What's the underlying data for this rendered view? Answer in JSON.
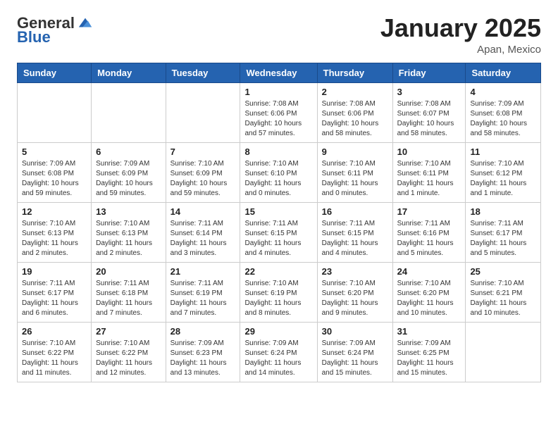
{
  "logo": {
    "general": "General",
    "blue": "Blue"
  },
  "title": {
    "month_year": "January 2025",
    "location": "Apan, Mexico"
  },
  "weekdays": [
    "Sunday",
    "Monday",
    "Tuesday",
    "Wednesday",
    "Thursday",
    "Friday",
    "Saturday"
  ],
  "weeks": [
    [
      {
        "day": "",
        "info": ""
      },
      {
        "day": "",
        "info": ""
      },
      {
        "day": "",
        "info": ""
      },
      {
        "day": "1",
        "info": "Sunrise: 7:08 AM\nSunset: 6:06 PM\nDaylight: 10 hours and 57 minutes."
      },
      {
        "day": "2",
        "info": "Sunrise: 7:08 AM\nSunset: 6:06 PM\nDaylight: 10 hours and 58 minutes."
      },
      {
        "day": "3",
        "info": "Sunrise: 7:08 AM\nSunset: 6:07 PM\nDaylight: 10 hours and 58 minutes."
      },
      {
        "day": "4",
        "info": "Sunrise: 7:09 AM\nSunset: 6:08 PM\nDaylight: 10 hours and 58 minutes."
      }
    ],
    [
      {
        "day": "5",
        "info": "Sunrise: 7:09 AM\nSunset: 6:08 PM\nDaylight: 10 hours and 59 minutes."
      },
      {
        "day": "6",
        "info": "Sunrise: 7:09 AM\nSunset: 6:09 PM\nDaylight: 10 hours and 59 minutes."
      },
      {
        "day": "7",
        "info": "Sunrise: 7:10 AM\nSunset: 6:09 PM\nDaylight: 10 hours and 59 minutes."
      },
      {
        "day": "8",
        "info": "Sunrise: 7:10 AM\nSunset: 6:10 PM\nDaylight: 11 hours and 0 minutes."
      },
      {
        "day": "9",
        "info": "Sunrise: 7:10 AM\nSunset: 6:11 PM\nDaylight: 11 hours and 0 minutes."
      },
      {
        "day": "10",
        "info": "Sunrise: 7:10 AM\nSunset: 6:11 PM\nDaylight: 11 hours and 1 minute."
      },
      {
        "day": "11",
        "info": "Sunrise: 7:10 AM\nSunset: 6:12 PM\nDaylight: 11 hours and 1 minute."
      }
    ],
    [
      {
        "day": "12",
        "info": "Sunrise: 7:10 AM\nSunset: 6:13 PM\nDaylight: 11 hours and 2 minutes."
      },
      {
        "day": "13",
        "info": "Sunrise: 7:10 AM\nSunset: 6:13 PM\nDaylight: 11 hours and 2 minutes."
      },
      {
        "day": "14",
        "info": "Sunrise: 7:11 AM\nSunset: 6:14 PM\nDaylight: 11 hours and 3 minutes."
      },
      {
        "day": "15",
        "info": "Sunrise: 7:11 AM\nSunset: 6:15 PM\nDaylight: 11 hours and 4 minutes."
      },
      {
        "day": "16",
        "info": "Sunrise: 7:11 AM\nSunset: 6:15 PM\nDaylight: 11 hours and 4 minutes."
      },
      {
        "day": "17",
        "info": "Sunrise: 7:11 AM\nSunset: 6:16 PM\nDaylight: 11 hours and 5 minutes."
      },
      {
        "day": "18",
        "info": "Sunrise: 7:11 AM\nSunset: 6:17 PM\nDaylight: 11 hours and 5 minutes."
      }
    ],
    [
      {
        "day": "19",
        "info": "Sunrise: 7:11 AM\nSunset: 6:17 PM\nDaylight: 11 hours and 6 minutes."
      },
      {
        "day": "20",
        "info": "Sunrise: 7:11 AM\nSunset: 6:18 PM\nDaylight: 11 hours and 7 minutes."
      },
      {
        "day": "21",
        "info": "Sunrise: 7:11 AM\nSunset: 6:19 PM\nDaylight: 11 hours and 7 minutes."
      },
      {
        "day": "22",
        "info": "Sunrise: 7:10 AM\nSunset: 6:19 PM\nDaylight: 11 hours and 8 minutes."
      },
      {
        "day": "23",
        "info": "Sunrise: 7:10 AM\nSunset: 6:20 PM\nDaylight: 11 hours and 9 minutes."
      },
      {
        "day": "24",
        "info": "Sunrise: 7:10 AM\nSunset: 6:20 PM\nDaylight: 11 hours and 10 minutes."
      },
      {
        "day": "25",
        "info": "Sunrise: 7:10 AM\nSunset: 6:21 PM\nDaylight: 11 hours and 10 minutes."
      }
    ],
    [
      {
        "day": "26",
        "info": "Sunrise: 7:10 AM\nSunset: 6:22 PM\nDaylight: 11 hours and 11 minutes."
      },
      {
        "day": "27",
        "info": "Sunrise: 7:10 AM\nSunset: 6:22 PM\nDaylight: 11 hours and 12 minutes."
      },
      {
        "day": "28",
        "info": "Sunrise: 7:09 AM\nSunset: 6:23 PM\nDaylight: 11 hours and 13 minutes."
      },
      {
        "day": "29",
        "info": "Sunrise: 7:09 AM\nSunset: 6:24 PM\nDaylight: 11 hours and 14 minutes."
      },
      {
        "day": "30",
        "info": "Sunrise: 7:09 AM\nSunset: 6:24 PM\nDaylight: 11 hours and 15 minutes."
      },
      {
        "day": "31",
        "info": "Sunrise: 7:09 AM\nSunset: 6:25 PM\nDaylight: 11 hours and 15 minutes."
      },
      {
        "day": "",
        "info": ""
      }
    ]
  ]
}
